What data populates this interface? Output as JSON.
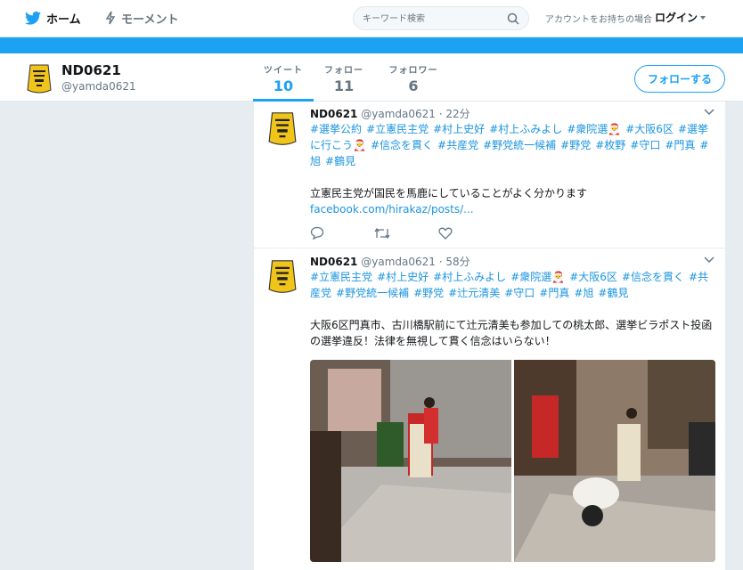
{
  "topnav": {
    "home_label": "ホーム",
    "moments_label": "モーメント",
    "search_placeholder": "キーワード検索",
    "account_prompt": "アカウントをお持ちの場合",
    "login_label": "ログイン"
  },
  "profile": {
    "name": "ND0621",
    "handle": "@yamda0621",
    "stats": [
      {
        "label": "ツイート",
        "value": "10"
      },
      {
        "label": "フォロー",
        "value": "11"
      },
      {
        "label": "フォロワー",
        "value": "6"
      }
    ],
    "follow_label": "フォローする"
  },
  "colors": {
    "accent": "#1da1f2",
    "link": "#1b95e0",
    "background": "#e6ecf0"
  },
  "tweets": [
    {
      "name": "ND0621",
      "handle": "@yamda0621",
      "time": "22分",
      "hashtags": [
        "#選挙公約",
        "#立憲民主党",
        "#村上史好",
        "#村上ふみよし",
        "#衆院選🎅",
        "#大阪6区",
        "#選挙に行こう🎅",
        "#信念を貫く",
        "#共産党",
        "#野党統一候補",
        "#野党",
        "#枚野",
        "#守口",
        "#門真",
        "#旭",
        "#鶴見"
      ],
      "body": "立憲民主党が国民を馬鹿にしていることがよく分かります",
      "link": "facebook.com/hirakaz/posts/..."
    },
    {
      "name": "ND0621",
      "handle": "@yamda0621",
      "time": "58分",
      "hashtags": [
        "#立憲民主党",
        "#村上史好",
        "#村上ふみよし",
        "#衆院選🎅",
        "#大阪6区",
        "#信念を貫く",
        "#共産党",
        "#野党統一候補",
        "#野党",
        "#辻元清美",
        "#守口",
        "#門真",
        "#旭",
        "#鶴見"
      ],
      "body": "大阪6区門真市、古川橋駅前にて辻元清美も参加しての桃太郎、選挙ビラポスト投函の選挙違反！法律を無視して貫く信念はいらない！"
    }
  ]
}
